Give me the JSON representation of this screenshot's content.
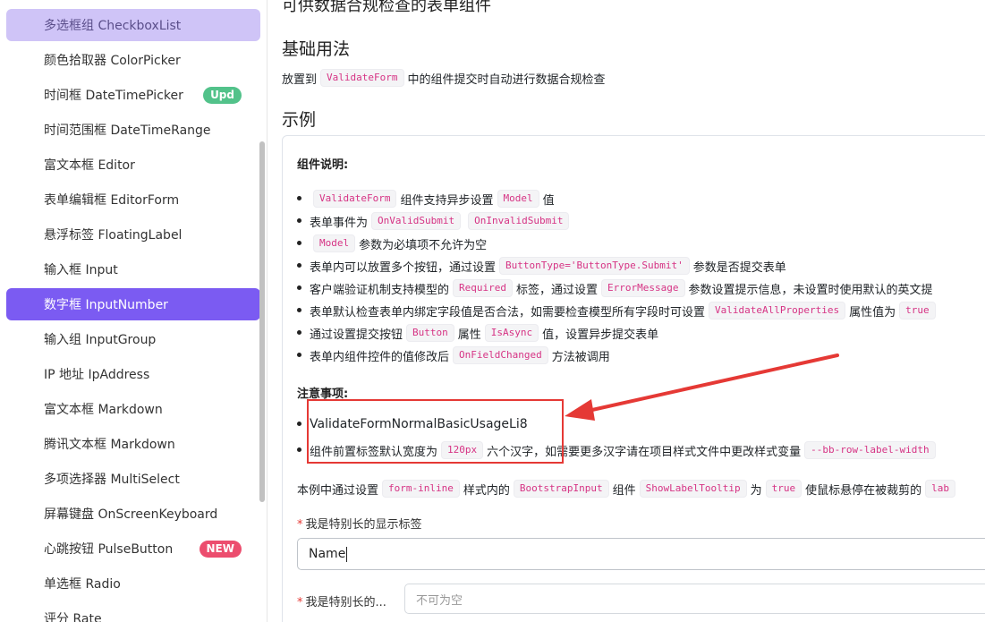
{
  "sidebar": {
    "items": [
      {
        "label": "多选框组 CheckboxList",
        "state": "hover"
      },
      {
        "label": "颜色拾取器 ColorPicker"
      },
      {
        "label": "时间框 DateTimePicker",
        "badge": "Upd"
      },
      {
        "label": "时间范围框 DateTimeRange"
      },
      {
        "label": "富文本框 Editor"
      },
      {
        "label": "表单编辑框 EditorForm"
      },
      {
        "label": "悬浮标签 FloatingLabel"
      },
      {
        "label": "输入框 Input"
      },
      {
        "label": "数字框 InputNumber",
        "state": "active"
      },
      {
        "label": "输入组 InputGroup"
      },
      {
        "label": "IP 地址 IpAddress"
      },
      {
        "label": "富文本框 Markdown"
      },
      {
        "label": "腾讯文本框 Markdown"
      },
      {
        "label": "多项选择器 MultiSelect"
      },
      {
        "label": "屏幕键盘 OnScreenKeyboard"
      },
      {
        "label": "心跳按钮 PulseButton",
        "badge": "NEW"
      },
      {
        "label": "单选框 Radio"
      },
      {
        "label": "评分 Rate"
      }
    ]
  },
  "main": {
    "top_heading": "可供数据合规检查的表单组件",
    "basic_title": "基础用法",
    "desc": {
      "pre": "放置到",
      "code": "ValidateForm",
      "post": "中的组件提交时自动进行数据合规检查"
    },
    "example_title": "示例",
    "component_title": "组件说明:",
    "items": [
      [
        {
          "c": "ValidateForm"
        },
        {
          "t": "组件支持异步设置"
        },
        {
          "c": "Model"
        },
        {
          "t": "值"
        }
      ],
      [
        {
          "t": "表单事件为"
        },
        {
          "c": "OnValidSubmit"
        },
        {
          "c": "OnInvalidSubmit"
        }
      ],
      [
        {
          "c": "Model"
        },
        {
          "t": "参数为必填项不允许为空"
        }
      ],
      [
        {
          "t": "表单内可以放置多个按钮，通过设置"
        },
        {
          "c": "ButtonType='ButtonType.Submit'"
        },
        {
          "t": "参数是否提交表单"
        }
      ],
      [
        {
          "t": "客户端验证机制支持模型的"
        },
        {
          "c": "Required"
        },
        {
          "t": "标签，通过设置"
        },
        {
          "c": "ErrorMessage"
        },
        {
          "t": "参数设置提示信息，未设置时使用默认的英文提"
        }
      ],
      [
        {
          "t": "表单默认检查表单内绑定字段值是否合法，如需要检查模型所有字段时可设置"
        },
        {
          "c": "ValidateAllProperties"
        },
        {
          "t": "属性值为"
        },
        {
          "c": "true"
        }
      ],
      [
        {
          "t": "通过设置提交按钮"
        },
        {
          "c": "Button"
        },
        {
          "t": "属性"
        },
        {
          "c": "IsAsync"
        },
        {
          "t": "值，设置异步提交表单"
        }
      ],
      [
        {
          "t": "表单内组件控件的值修改后"
        },
        {
          "c": "OnFieldChanged"
        },
        {
          "t": "方法被调用"
        }
      ]
    ],
    "notes_title": "注意事项:",
    "notes": [
      [
        {
          "t": "ValidateFormNormalBasicUsageLi8"
        }
      ],
      [
        {
          "t": "组件前置标签默认宽度为"
        },
        {
          "c": "120px"
        },
        {
          "t": "六个汉字，如需要更多汉字请在项目样式文件中更改样式变量"
        },
        {
          "c": "--bb-row-label-width"
        }
      ]
    ],
    "para": [
      {
        "t": "本例中通过设置"
      },
      {
        "c": "form-inline"
      },
      {
        "t": "样式内的"
      },
      {
        "c": "BootstrapInput"
      },
      {
        "t": "组件"
      },
      {
        "c": "ShowLabelTooltip"
      },
      {
        "t": "为"
      },
      {
        "c": "true"
      },
      {
        "t": "使鼠标悬停在被裁剪的"
      },
      {
        "c": "lab"
      }
    ],
    "field1": {
      "required": "*",
      "label": "我是特别长的显示标签",
      "value": "Name"
    },
    "field2": {
      "required": "*",
      "label": "我是特别长的...",
      "placeholder": "不可为空"
    }
  },
  "colors": {
    "accent": "#7b5bf2",
    "hover": "#cfc4f7",
    "annotation": "#e53935",
    "code": "#d63384"
  }
}
